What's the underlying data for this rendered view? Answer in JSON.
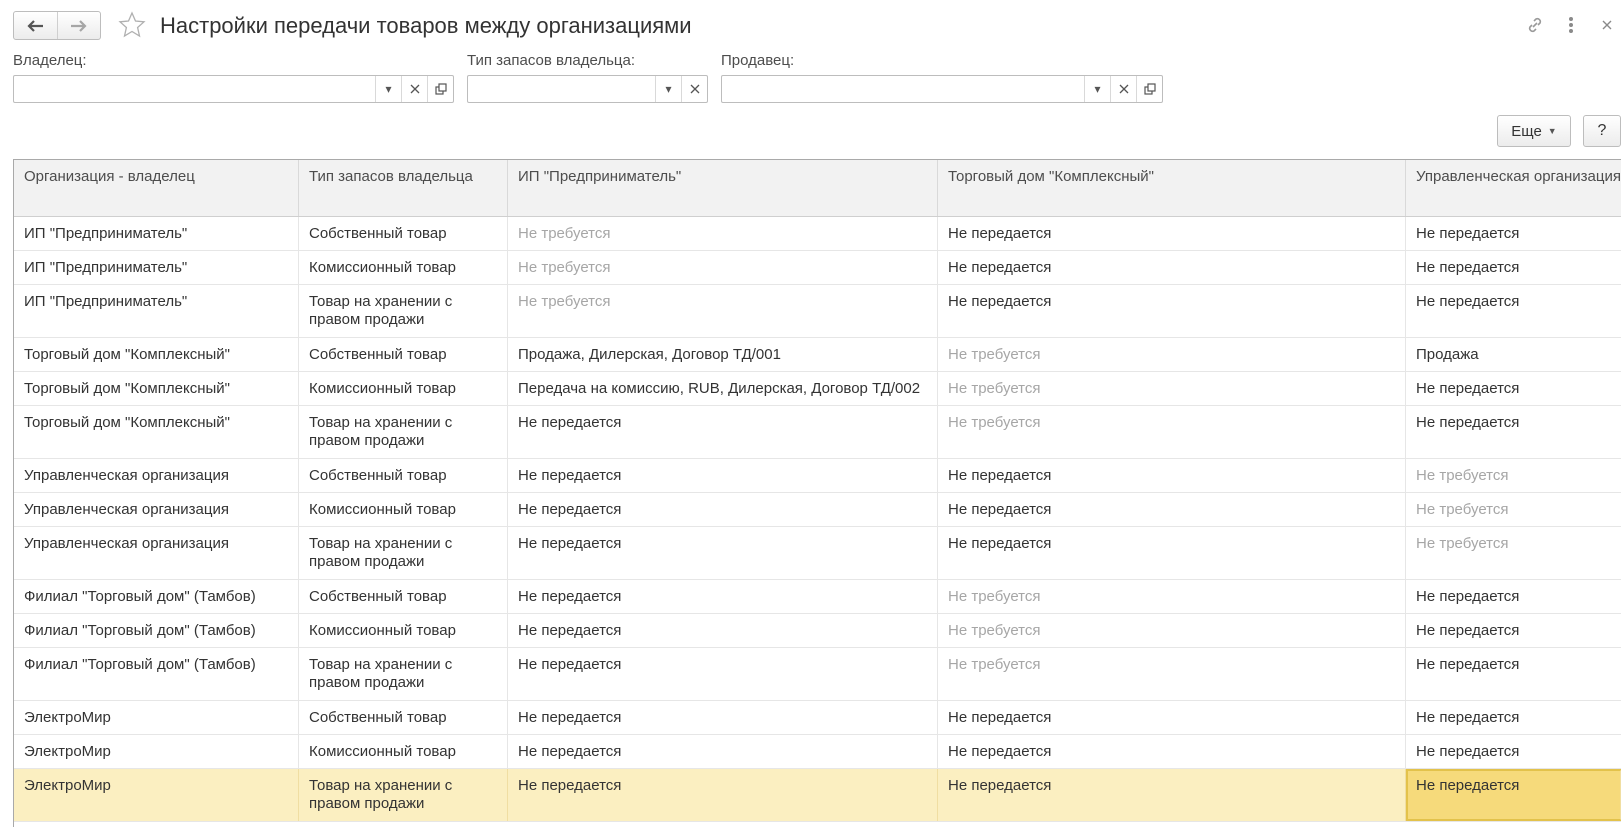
{
  "window": {
    "title": "Настройки передачи товаров между организациями"
  },
  "icons": {
    "back": "arrow-left-icon",
    "forward": "arrow-right-icon",
    "favorite": "star-icon",
    "link": "link-icon",
    "menu": "more-vertical-icon",
    "close": "close-icon"
  },
  "filters": {
    "owner": {
      "label": "Владелец:",
      "value": ""
    },
    "stock_type": {
      "label": "Тип запасов владельца:",
      "value": ""
    },
    "seller": {
      "label": "Продавец:",
      "value": ""
    }
  },
  "toolbar": {
    "more_label": "Еще",
    "help_label": "?"
  },
  "table": {
    "columns": [
      "Организация - владелец",
      "Тип запасов владельца",
      "ИП \"Предприниматель\"",
      "Торговый дом \"Комплексный\"",
      "Управленческая организация"
    ],
    "rows": [
      {
        "owner": "ИП \"Предприниматель\"",
        "stock": "Собственный товар",
        "ip": "Не требуется",
        "td": "Не передается",
        "uo": "Не передается"
      },
      {
        "owner": "ИП \"Предприниматель\"",
        "stock": "Комиссионный товар",
        "ip": "Не требуется",
        "td": "Не передается",
        "uo": "Не передается"
      },
      {
        "owner": "ИП \"Предприниматель\"",
        "stock": "Товар на хранении с правом продажи",
        "ip": "Не требуется",
        "td": "Не передается",
        "uo": "Не передается"
      },
      {
        "owner": "Торговый дом \"Комплексный\"",
        "stock": "Собственный товар",
        "ip": "Продажа, Дилерская, Договор ТД/001",
        "td": "Не требуется",
        "uo": "Продажа"
      },
      {
        "owner": "Торговый дом \"Комплексный\"",
        "stock": "Комиссионный товар",
        "ip": "Передача на комиссию, RUB, Дилерская, Договор ТД/002",
        "td": "Не требуется",
        "uo": "Не передается"
      },
      {
        "owner": "Торговый дом \"Комплексный\"",
        "stock": "Товар на хранении с правом продажи",
        "ip": "Не передается",
        "td": "Не требуется",
        "uo": "Не передается"
      },
      {
        "owner": "Управленческая организация",
        "stock": "Собственный товар",
        "ip": "Не передается",
        "td": "Не передается",
        "uo": "Не требуется"
      },
      {
        "owner": "Управленческая организация",
        "stock": "Комиссионный товар",
        "ip": "Не передается",
        "td": "Не передается",
        "uo": "Не требуется"
      },
      {
        "owner": "Управленческая организация",
        "stock": "Товар на хранении с правом продажи",
        "ip": "Не передается",
        "td": "Не передается",
        "uo": "Не требуется"
      },
      {
        "owner": "Филиал \"Торговый дом\" (Тамбов)",
        "stock": "Собственный товар",
        "ip": "Не передается",
        "td": "Не требуется",
        "uo": "Не передается"
      },
      {
        "owner": "Филиал \"Торговый дом\" (Тамбов)",
        "stock": "Комиссионный товар",
        "ip": "Не передается",
        "td": "Не требуется",
        "uo": "Не передается"
      },
      {
        "owner": "Филиал \"Торговый дом\" (Тамбов)",
        "stock": "Товар на хранении с правом продажи",
        "ip": "Не передается",
        "td": "Не требуется",
        "uo": "Не передается"
      },
      {
        "owner": "ЭлектроМир",
        "stock": "Собственный товар",
        "ip": "Не передается",
        "td": "Не передается",
        "uo": "Не передается"
      },
      {
        "owner": "ЭлектроМир",
        "stock": "Комиссионный товар",
        "ip": "Не передается",
        "td": "Не передается",
        "uo": "Не передается"
      },
      {
        "owner": "ЭлектроМир",
        "stock": "Товар на хранении с правом продажи",
        "ip": "Не передается",
        "td": "Не передается",
        "uo": "Не передается"
      }
    ],
    "muted_value": "Не требуется",
    "selected_row": 14,
    "colors": {
      "selected_row_bg": "#fbefc1",
      "current_cell_bg": "#f6da7b",
      "muted_text": "#a6a6a6"
    }
  }
}
